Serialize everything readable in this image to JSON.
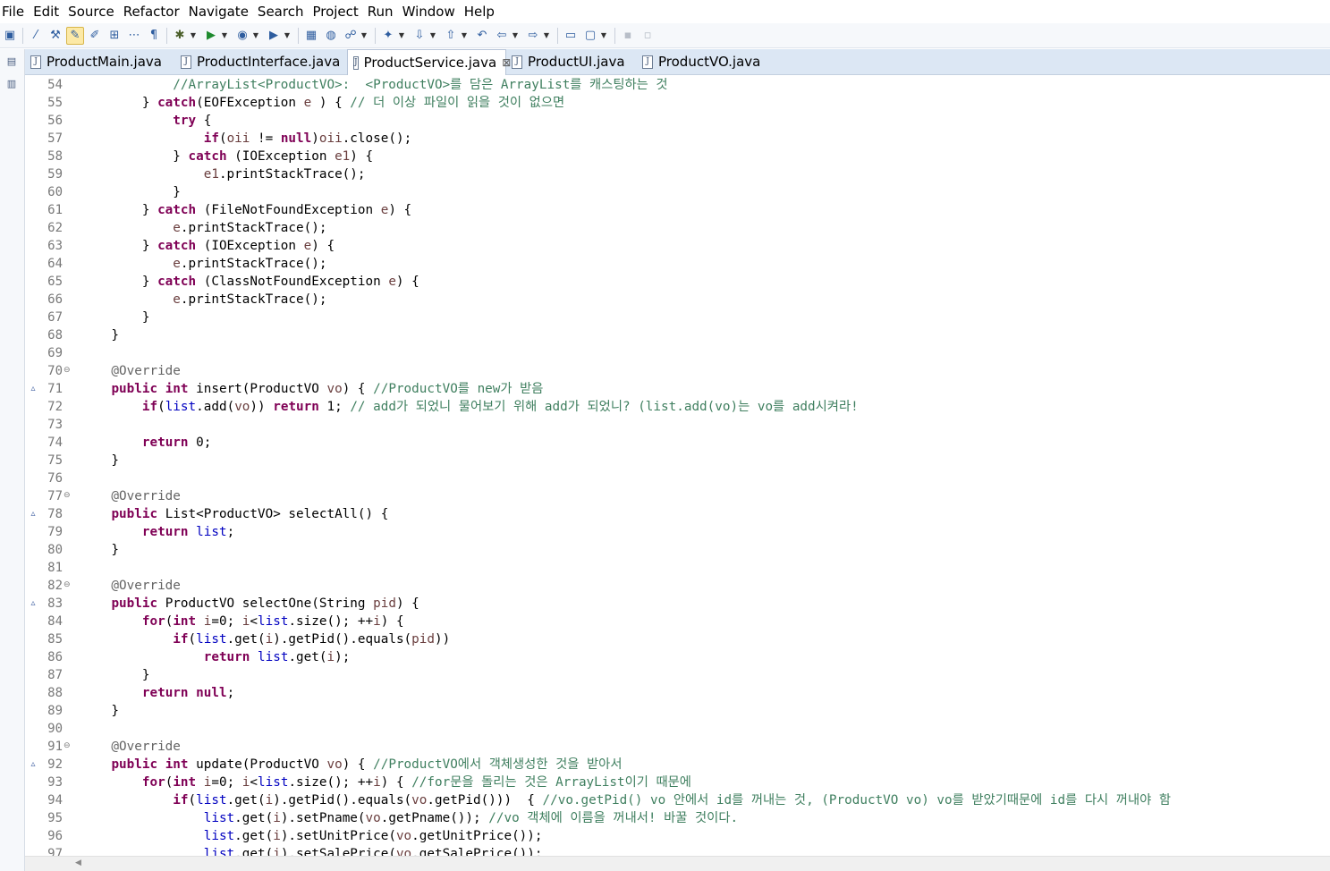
{
  "menu": [
    "File",
    "Edit",
    "Source",
    "Refactor",
    "Navigate",
    "Search",
    "Project",
    "Run",
    "Window",
    "Help"
  ],
  "toolbar_icons": [
    "console-icon",
    "pin-icon",
    "external-tools-icon",
    "toggle-mark-icon",
    "mark-occurrences-icon",
    "block-selection-icon",
    "whitespace-icon",
    "paragraph-icon",
    "debug-icon",
    "run-icon",
    "coverage-icon",
    "run-external-icon",
    "new-java-project-icon",
    "new-class-icon",
    "open-type-icon",
    "search-icon",
    "next-annotation-icon",
    "prev-annotation-icon",
    "last-edit-icon",
    "back-icon",
    "forward-icon",
    "open-perspective-icon",
    "new-window-icon",
    "save-icon",
    "save-all-icon"
  ],
  "tabs": [
    {
      "label": "ProductMain.java",
      "active": false
    },
    {
      "label": "ProductInterface.java",
      "active": false
    },
    {
      "label": "ProductService.java",
      "active": true
    },
    {
      "label": "ProductUI.java",
      "active": false
    },
    {
      "label": "ProductVO.java",
      "active": false
    }
  ],
  "tab_close_glyph": "⊠",
  "code_lines": [
    {
      "n": "54",
      "segs": [
        [
          "cm",
          "            //ArrayList<ProductVO>:  <ProductVO>를 담은 ArrayList를 캐스팅하는 것"
        ]
      ]
    },
    {
      "n": "55",
      "segs": [
        [
          "",
          "        } "
        ],
        [
          "kw",
          "catch"
        ],
        [
          "",
          "(EOFException "
        ],
        [
          "lv",
          "e"
        ],
        [
          "",
          " ) { "
        ],
        [
          "cm",
          "// 더 이상 파일이 읽을 것이 없으면"
        ]
      ]
    },
    {
      "n": "56",
      "segs": [
        [
          "",
          "            "
        ],
        [
          "kw",
          "try"
        ],
        [
          "",
          " {"
        ]
      ]
    },
    {
      "n": "57",
      "segs": [
        [
          "",
          "                "
        ],
        [
          "kw",
          "if"
        ],
        [
          "",
          "("
        ],
        [
          "lv",
          "oii"
        ],
        [
          "",
          " != "
        ],
        [
          "kw",
          "null"
        ],
        [
          "",
          ")"
        ],
        [
          "lv",
          "oii"
        ],
        [
          "",
          ".close();"
        ]
      ]
    },
    {
      "n": "58",
      "segs": [
        [
          "",
          "            } "
        ],
        [
          "kw",
          "catch"
        ],
        [
          "",
          " (IOException "
        ],
        [
          "lv",
          "e1"
        ],
        [
          "",
          ") {"
        ]
      ]
    },
    {
      "n": "59",
      "segs": [
        [
          "",
          "                "
        ],
        [
          "lv",
          "e1"
        ],
        [
          "",
          ".printStackTrace();"
        ]
      ]
    },
    {
      "n": "60",
      "segs": [
        [
          "",
          "            }"
        ]
      ]
    },
    {
      "n": "61",
      "segs": [
        [
          "",
          "        } "
        ],
        [
          "kw",
          "catch"
        ],
        [
          "",
          " (FileNotFoundException "
        ],
        [
          "lv",
          "e"
        ],
        [
          "",
          ") {"
        ]
      ]
    },
    {
      "n": "62",
      "segs": [
        [
          "",
          "            "
        ],
        [
          "lv",
          "e"
        ],
        [
          "",
          ".printStackTrace();"
        ]
      ]
    },
    {
      "n": "63",
      "segs": [
        [
          "",
          "        } "
        ],
        [
          "kw",
          "catch"
        ],
        [
          "",
          " (IOException "
        ],
        [
          "lv",
          "e"
        ],
        [
          "",
          ") {"
        ]
      ]
    },
    {
      "n": "64",
      "segs": [
        [
          "",
          "            "
        ],
        [
          "lv",
          "e"
        ],
        [
          "",
          ".printStackTrace();"
        ]
      ]
    },
    {
      "n": "65",
      "segs": [
        [
          "",
          "        } "
        ],
        [
          "kw",
          "catch"
        ],
        [
          "",
          " (ClassNotFoundException "
        ],
        [
          "lv",
          "e"
        ],
        [
          "",
          ") {"
        ]
      ]
    },
    {
      "n": "66",
      "segs": [
        [
          "",
          "            "
        ],
        [
          "lv",
          "e"
        ],
        [
          "",
          ".printStackTrace();"
        ]
      ]
    },
    {
      "n": "67",
      "segs": [
        [
          "",
          "        }"
        ]
      ]
    },
    {
      "n": "68",
      "segs": [
        [
          "",
          "    }"
        ]
      ]
    },
    {
      "n": "69",
      "segs": []
    },
    {
      "n": "70",
      "fold": true,
      "segs": [
        [
          "an",
          "    @Override"
        ]
      ]
    },
    {
      "n": "71",
      "override": true,
      "segs": [
        [
          "",
          "    "
        ],
        [
          "kw",
          "public"
        ],
        [
          "",
          " "
        ],
        [
          "kw",
          "int"
        ],
        [
          "",
          " insert(ProductVO "
        ],
        [
          "lv",
          "vo"
        ],
        [
          "",
          ") { "
        ],
        [
          "cm",
          "//ProductVO를 new가 받음"
        ]
      ]
    },
    {
      "n": "72",
      "segs": [
        [
          "",
          "        "
        ],
        [
          "kw",
          "if"
        ],
        [
          "",
          "("
        ],
        [
          "fd",
          "list"
        ],
        [
          "",
          ".add("
        ],
        [
          "lv",
          "vo"
        ],
        [
          "",
          ")) "
        ],
        [
          "kw",
          "return"
        ],
        [
          "",
          " 1; "
        ],
        [
          "cm",
          "// add가 되었니 물어보기 위해 add가 되었니? (list.add(vo)는 vo를 add시켜라!"
        ]
      ]
    },
    {
      "n": "73",
      "segs": []
    },
    {
      "n": "74",
      "segs": [
        [
          "",
          "        "
        ],
        [
          "kw",
          "return"
        ],
        [
          "",
          " 0;"
        ]
      ]
    },
    {
      "n": "75",
      "segs": [
        [
          "",
          "    }"
        ]
      ]
    },
    {
      "n": "76",
      "segs": []
    },
    {
      "n": "77",
      "fold": true,
      "segs": [
        [
          "an",
          "    @Override"
        ]
      ]
    },
    {
      "n": "78",
      "override": true,
      "segs": [
        [
          "",
          "    "
        ],
        [
          "kw",
          "public"
        ],
        [
          "",
          " List<ProductVO> selectAll() {"
        ]
      ]
    },
    {
      "n": "79",
      "segs": [
        [
          "",
          "        "
        ],
        [
          "kw",
          "return"
        ],
        [
          "",
          " "
        ],
        [
          "fd",
          "list"
        ],
        [
          "",
          ";"
        ]
      ]
    },
    {
      "n": "80",
      "segs": [
        [
          "",
          "    }"
        ]
      ]
    },
    {
      "n": "81",
      "segs": []
    },
    {
      "n": "82",
      "fold": true,
      "segs": [
        [
          "an",
          "    @Override"
        ]
      ]
    },
    {
      "n": "83",
      "override": true,
      "segs": [
        [
          "",
          "    "
        ],
        [
          "kw",
          "public"
        ],
        [
          "",
          " ProductVO selectOne(String "
        ],
        [
          "lv",
          "pid"
        ],
        [
          "",
          ") {"
        ]
      ]
    },
    {
      "n": "84",
      "segs": [
        [
          "",
          "        "
        ],
        [
          "kw",
          "for"
        ],
        [
          "",
          "("
        ],
        [
          "kw",
          "int"
        ],
        [
          "",
          " "
        ],
        [
          "lv",
          "i"
        ],
        [
          "",
          "=0; "
        ],
        [
          "lv",
          "i"
        ],
        [
          "",
          "<"
        ],
        [
          "fd",
          "list"
        ],
        [
          "",
          ".size(); ++"
        ],
        [
          "lv",
          "i"
        ],
        [
          "",
          ") {"
        ]
      ]
    },
    {
      "n": "85",
      "segs": [
        [
          "",
          "            "
        ],
        [
          "kw",
          "if"
        ],
        [
          "",
          "("
        ],
        [
          "fd",
          "list"
        ],
        [
          "",
          ".get("
        ],
        [
          "lv",
          "i"
        ],
        [
          "",
          ").getPid().equals("
        ],
        [
          "lv",
          "pid"
        ],
        [
          "",
          "))"
        ]
      ]
    },
    {
      "n": "86",
      "segs": [
        [
          "",
          "                "
        ],
        [
          "kw",
          "return"
        ],
        [
          "",
          " "
        ],
        [
          "fd",
          "list"
        ],
        [
          "",
          ".get("
        ],
        [
          "lv",
          "i"
        ],
        [
          "",
          ");"
        ]
      ]
    },
    {
      "n": "87",
      "segs": [
        [
          "",
          "        }"
        ]
      ]
    },
    {
      "n": "88",
      "segs": [
        [
          "",
          "        "
        ],
        [
          "kw",
          "return"
        ],
        [
          "",
          " "
        ],
        [
          "kw",
          "null"
        ],
        [
          "",
          ";"
        ]
      ]
    },
    {
      "n": "89",
      "segs": [
        [
          "",
          "    }"
        ]
      ]
    },
    {
      "n": "90",
      "segs": []
    },
    {
      "n": "91",
      "fold": true,
      "segs": [
        [
          "an",
          "    @Override"
        ]
      ]
    },
    {
      "n": "92",
      "override": true,
      "segs": [
        [
          "",
          "    "
        ],
        [
          "kw",
          "public"
        ],
        [
          "",
          " "
        ],
        [
          "kw",
          "int"
        ],
        [
          "",
          " update(ProductVO "
        ],
        [
          "lv",
          "vo"
        ],
        [
          "",
          ") { "
        ],
        [
          "cm",
          "//ProductVO에서 객체생성한 것을 받아서"
        ]
      ]
    },
    {
      "n": "93",
      "segs": [
        [
          "",
          "        "
        ],
        [
          "kw",
          "for"
        ],
        [
          "",
          "("
        ],
        [
          "kw",
          "int"
        ],
        [
          "",
          " "
        ],
        [
          "lv",
          "i"
        ],
        [
          "",
          "=0; "
        ],
        [
          "lv",
          "i"
        ],
        [
          "",
          "<"
        ],
        [
          "fd",
          "list"
        ],
        [
          "",
          ".size(); ++"
        ],
        [
          "lv",
          "i"
        ],
        [
          "",
          ") { "
        ],
        [
          "cm",
          "//for문을 돌리는 것은 ArrayList이기 때문에"
        ]
      ]
    },
    {
      "n": "94",
      "segs": [
        [
          "",
          "            "
        ],
        [
          "kw",
          "if"
        ],
        [
          "",
          "("
        ],
        [
          "fd",
          "list"
        ],
        [
          "",
          ".get("
        ],
        [
          "lv",
          "i"
        ],
        [
          "",
          ").getPid().equals("
        ],
        [
          "lv",
          "vo"
        ],
        [
          "",
          ".getPid()))  { "
        ],
        [
          "cm",
          "//vo.getPid() vo 안에서 id를 꺼내는 것, (ProductVO vo) vo를 받았기때문에 id를 다시 꺼내야 함"
        ]
      ]
    },
    {
      "n": "95",
      "segs": [
        [
          "",
          "                "
        ],
        [
          "fd",
          "list"
        ],
        [
          "",
          ".get("
        ],
        [
          "lv",
          "i"
        ],
        [
          "",
          ").setPname("
        ],
        [
          "lv",
          "vo"
        ],
        [
          "",
          ".getPname()); "
        ],
        [
          "cm",
          "//vo 객체에 이름을 꺼내서! 바꿀 것이다."
        ]
      ]
    },
    {
      "n": "96",
      "segs": [
        [
          "",
          "                "
        ],
        [
          "fd",
          "list"
        ],
        [
          "",
          ".get("
        ],
        [
          "lv",
          "i"
        ],
        [
          "",
          ").setUnitPrice("
        ],
        [
          "lv",
          "vo"
        ],
        [
          "",
          ".getUnitPrice());"
        ]
      ]
    },
    {
      "n": "97",
      "segs": [
        [
          "",
          "                "
        ],
        [
          "fd",
          "list"
        ],
        [
          "",
          ".get("
        ],
        [
          "lv",
          "i"
        ],
        [
          "",
          ").setSalePrice("
        ],
        [
          "lv",
          "vo"
        ],
        [
          "",
          ".getSalePrice());"
        ]
      ]
    }
  ]
}
